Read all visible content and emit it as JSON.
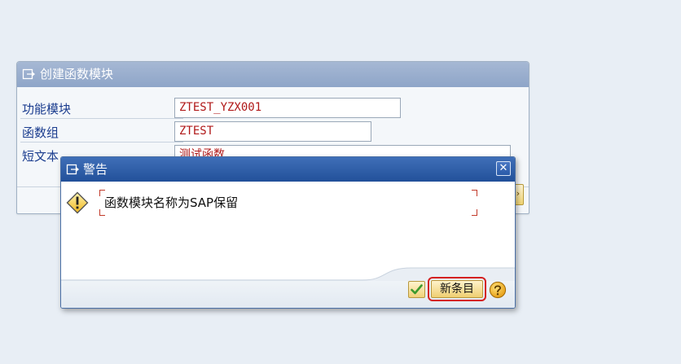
{
  "background_dialog": {
    "title": "创建函数模块",
    "fields": [
      {
        "label": "功能模块",
        "value": "ZTEST_YZX001"
      },
      {
        "label": "函数组",
        "value": "ZTEST"
      },
      {
        "label": "短文本",
        "value": "测试函数"
      }
    ]
  },
  "warning_popup": {
    "title": "警告",
    "message": "函数模块名称为SAP保留",
    "buttons": {
      "new_entry_label": "新条目"
    }
  },
  "icons": [
    "window-icon",
    "warning-icon",
    "close-icon",
    "checkmark-icon",
    "help-icon"
  ],
  "colors": {
    "popup_title_bar": "#2c5ba4",
    "field_label": "#1b3d8f",
    "field_value": "#b01818",
    "highlight_outline": "#d42020",
    "button_fill": "#f3d87f"
  }
}
